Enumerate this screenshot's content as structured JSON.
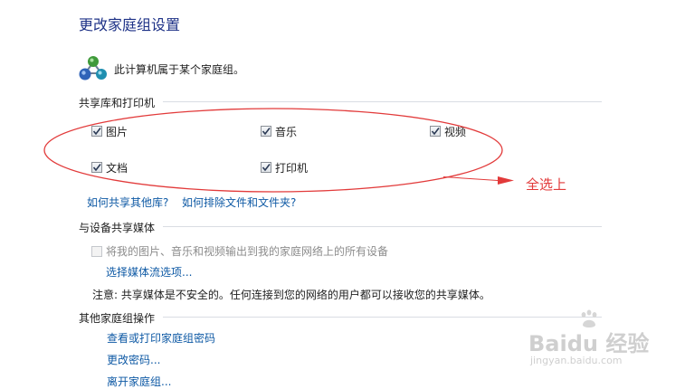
{
  "page": {
    "title": "更改家庭组设置",
    "intro": "此计算机属于某个家庭组。"
  },
  "libraries": {
    "section_title": "共享库和打印机",
    "items": [
      {
        "label": "图片",
        "checked": true
      },
      {
        "label": "音乐",
        "checked": true
      },
      {
        "label": "视频",
        "checked": true
      },
      {
        "label": "文档",
        "checked": true
      },
      {
        "label": "打印机",
        "checked": true
      }
    ],
    "link_other_libraries": "如何共享其他库?",
    "link_exclude": "如何排除文件和文件夹?"
  },
  "media": {
    "section_title": "与设备共享媒体",
    "stream_option": {
      "label": "将我的图片、音乐和视频输出到我的家庭网络上的所有设备",
      "checked": false,
      "enabled": false
    },
    "link_stream_options": "选择媒体流选项...",
    "note": "注意: 共享媒体是不安全的。任何连接到您的网络的用户都可以接收您的共享媒体。"
  },
  "other": {
    "section_title": "其他家庭组操作",
    "links": [
      "查看或打印家庭组密码",
      "更改密码...",
      "离开家庭组..."
    ]
  },
  "annotation": {
    "text": "全选上",
    "color": "#e23a3a"
  },
  "watermark": {
    "brand": "Baidu 经验",
    "url": "jingyan.baidu.com"
  },
  "colors": {
    "title": "#1e3287",
    "link": "#0f5aa5",
    "annotation": "#e23a3a"
  }
}
